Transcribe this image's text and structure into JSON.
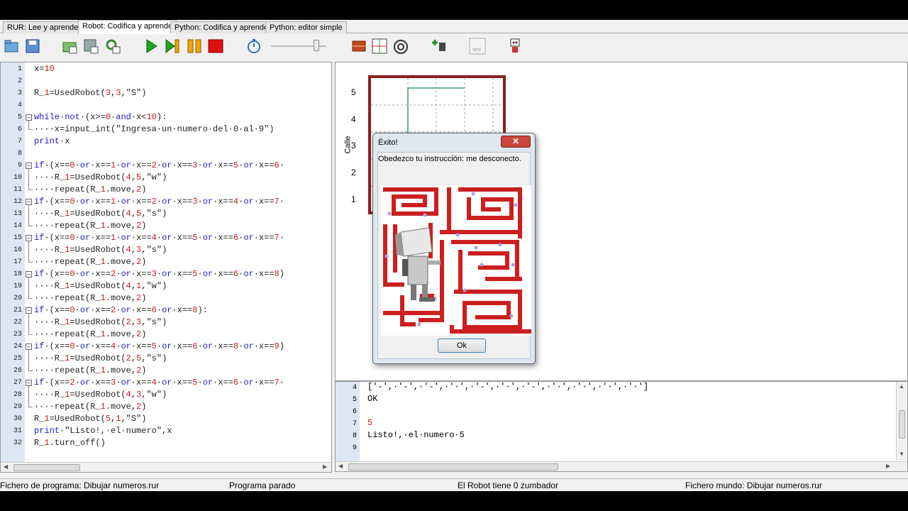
{
  "tabs": [
    "RUR: Lee y aprende",
    "Robot: Codifica y aprende",
    "Python: Codifica y aprende",
    "Python: editor simple"
  ],
  "editor": {
    "line_numbers": [
      "1",
      "2",
      "3",
      "4",
      "5",
      "6",
      "7",
      "8",
      "9",
      "10",
      "11",
      "12",
      "13",
      "14",
      "15",
      "16",
      "17",
      "18",
      "19",
      "20",
      "21",
      "22",
      "23",
      "24",
      "25",
      "26",
      "27",
      "28",
      "29",
      "30",
      "31",
      "32"
    ],
    "lines": [
      "x=10",
      "",
      "R_1=UsedRobot(3,3,\"S\")",
      "",
      "while·not·(x>=0·and·x<10):",
      "····x=input_int(\"Ingresa·un·numero·del·0·al·9\")",
      "print·x",
      "",
      "if·(x==0·or·x==1·or·x==2·or·x==3·or·x==5·or·x==6·",
      "····R_1=UsedRobot(4,5,\"w\")",
      "····repeat(R_1.move,2)",
      "if·(x==0·or·x==1·or·x==2·or·x==3·or·x==4·or·x==7·",
      "····R_1=UsedRobot(4,5,\"s\")",
      "····repeat(R_1.move,2)",
      "if·(x==0·or·x==1·or·x==4·or·x==5·or·x==6·or·x==7·",
      "····R_1=UsedRobot(4,3,\"s\")",
      "····repeat(R_1.move,2)",
      "if·(x==0·or·x==2·or·x==3·or·x==5·or·x==6·or·x==8)",
      "····R_1=UsedRobot(4,1,\"w\")",
      "····repeat(R_1.move,2)",
      "if·(x==0·or·x==2·or·x==6·or·x==8):",
      "····R_1=UsedRobot(2,3,\"s\")",
      "····repeat(R_1.move,2)",
      "if·(x==0·or·x==4·or·x==5·or·x==6·or·x==8·or·x==9)",
      "····R_1=UsedRobot(2,5,\"s\")",
      "····repeat(R_1.move,2)",
      "if·(x==2·or·x==3·or·x==4·or·x==5·or·x==6·or·x==7·",
      "····R_1=UsedRobot(4,3,\"w\")",
      "····repeat(R_1.move,2)",
      "R_1=UsedRobot(5,1,\"S\")",
      "print·\"Listo!,·el·numero\",x",
      "R_1.turn_off()"
    ]
  },
  "world": {
    "y_labels": [
      "5",
      "4",
      "3",
      "2",
      "1"
    ],
    "axis_label": "Calle"
  },
  "output": {
    "line_numbers": [
      "4",
      "5",
      "6",
      "7",
      "8",
      "9"
    ],
    "lines": [
      "['-',·'-',·'-',·'·',·'-',·'·',·'-',·'·',·'·',·'·',·'·']",
      "OK",
      "",
      "5",
      "Listo!,·el·numero·5",
      ""
    ]
  },
  "dialog": {
    "title": "Éxito!",
    "close": "✕",
    "message": "Obedezco tu instrucción: me desconecto.",
    "ok_label": "Ok"
  },
  "status": {
    "program_file": "Fichero de programa: Dibujar numeros.rur",
    "program_state": "Programa parado",
    "beepers": "El Robot tiene 0 zumbador",
    "world_file": "Fichero mundo: Dibujar numeros.rur"
  },
  "toolbar": {
    "icons": [
      "open-program-icon",
      "save-program-icon",
      "open-world-icon",
      "save-world-icon",
      "reload-icon",
      "run-icon",
      "step-icon",
      "pause-icon",
      "stop-icon",
      "timer-icon",
      "speed-slider",
      "editor-wall-icon",
      "beeper-icon",
      "highlight-icon",
      "add-robot-icon",
      "world-builder-icon",
      "robot-avatar-icon"
    ]
  },
  "colors": {
    "wall_red": "#cc1f1f",
    "keyword_blue": "#1a1ac8",
    "number_red": "#c02020",
    "gutter": "#dde6f2"
  }
}
